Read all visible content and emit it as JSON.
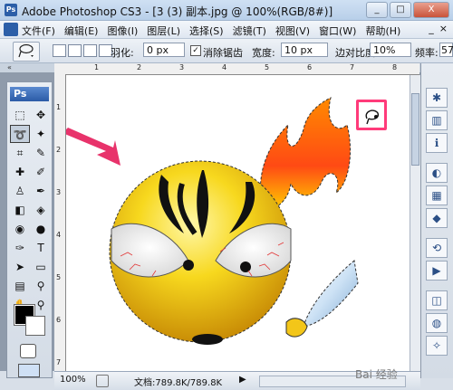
{
  "titlebar": {
    "app_title": "Adobe Photoshop CS3 - [3 (3) 副本.jpg @ 100%(RGB/8#)]",
    "min": "_",
    "max": "□",
    "close": "X"
  },
  "menubar": {
    "items": [
      "文件(F)",
      "编辑(E)",
      "图像(I)",
      "图层(L)",
      "选择(S)",
      "滤镜(T)",
      "视图(V)",
      "窗口(W)",
      "帮助(H)"
    ],
    "controls": [
      "_",
      "×"
    ]
  },
  "options": {
    "feather_label": "羽化:",
    "feather_value": "0 px",
    "antialias_label": "消除锯齿",
    "antialias_checked": "✓",
    "width_label": "宽度:",
    "width_value": "10 px",
    "contrast_label": "边对比度:",
    "contrast_value": "10%",
    "freq_label": "频率:",
    "freq_value": "57"
  },
  "ruler": {
    "h": [
      "1",
      "2",
      "3",
      "4",
      "5",
      "6",
      "7",
      "8"
    ],
    "v": [
      "1",
      "2",
      "3",
      "4",
      "5",
      "6",
      "7"
    ]
  },
  "toolbox": {
    "logo": "Ps"
  },
  "statusbar": {
    "zoom": "100%",
    "doc": "文档:789.8K/789.8K",
    "arrow": "▶"
  },
  "watermark": "Bai 经验",
  "colors": {
    "highlight": "#ff3b7a",
    "arrow": "#e8336b",
    "face": "#f5d21a"
  }
}
